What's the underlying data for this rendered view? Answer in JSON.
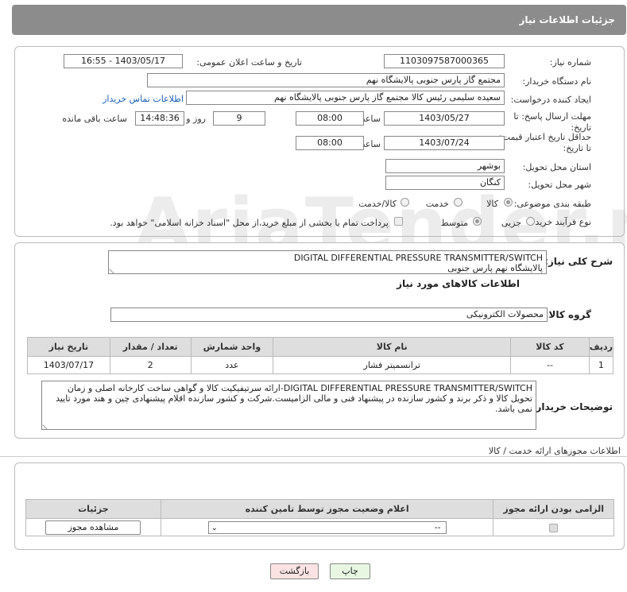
{
  "header": {
    "title": "جزئیات اطلاعات نیاز"
  },
  "form": {
    "need_number_label": "شماره نیاز:",
    "need_number": "1103097587000365",
    "announce_label": "تاریخ و ساعت اعلان عمومی:",
    "announce_value": "1403/05/17 - 16:55",
    "buyer_label": "نام دستگاه خریدار:",
    "buyer_value": "مجتمع گاز پارس جنوبی  پالایشگاه نهم",
    "creator_label": "ایجاد کننده درخواست:",
    "creator_value": "سعیده سلیمی رئیس کالا مجتمع گاز پارس جنوبی  پالایشگاه نهم",
    "contact_link": "اطلاعات تماس خریدار",
    "send_deadline_label": "مهلت ارسال پاسخ: تا تاریخ:",
    "send_date": "1403/05/27",
    "time_label": "ساعت",
    "send_time": "08:00",
    "days_value": "9",
    "days_label": "روز و",
    "remaining_time": "14:48:36",
    "remaining_label": "ساعت باقی مانده",
    "validity_label": "حداقل تاریخ اعتبار قیمت: تا تاریخ:",
    "validity_date": "1403/07/24",
    "validity_time_label": "ساعت",
    "validity_time": "08:00",
    "province_label": "استان محل تحویل:",
    "province_value": "بوشهر",
    "city_label": "شهر محل تحویل:",
    "city_value": "کنگان",
    "category_label": "طبقه بندی موضوعی:",
    "category_options": [
      "کالا",
      "خدمت",
      "کالا/خدمت"
    ],
    "process_label": "نوع فرآیند خرید :",
    "process_options": [
      "جزیی",
      "متوسط"
    ],
    "payment_note": "پرداخت تمام یا بخشی از مبلغ خرید،از محل \"اسناد خزانه اسلامی\" خواهد بود."
  },
  "watermark": "AriaTender.net",
  "description": {
    "label": "شرح کلی نیاز:",
    "line1": "DIGITAL DIFFERENTIAL PRESSURE TRANSMITTER/SWITCH",
    "line2": "پالایشگاه نهم پارس جنوبی"
  },
  "goods": {
    "section_title": "اطلاعات کالاهای مورد نیاز",
    "group_label": "گروه کالا:",
    "group_value": "محصولات الکترونیکی",
    "columns": [
      "ردیف",
      "کد کالا",
      "نام کالا",
      "واحد شمارش",
      "تعداد / مقدار",
      "تاریخ نیاز"
    ],
    "rows": [
      {
        "row": "1",
        "code": "--",
        "name": "ترانسمیتر فشار",
        "unit": "عدد",
        "qty": "2",
        "date": "1403/07/17"
      }
    ]
  },
  "buyer_notes": {
    "label": "توضیحات خریدار:",
    "text": "DIGITAL DIFFERENTIAL PRESSURE TRANSMITTER/SWITCH-ارائه سرتیفیکیت کالا و گواهی ساخت کارخانه اصلی و زمان تحویل کالا و ذکر برند و کشور سازنده در پیشنهاد فنی و مالی الزامیست.شرکت و کشور سازنده اقلام پیشنهادی چین و هند مورد تایید نمی باشد."
  },
  "permits": {
    "section_title": "اطلاعات مجوزهای ارائه خدمت / کالا",
    "columns": [
      "الزامی بودن ارائه مجوز",
      "اعلام وضعیت مجوز توسط تامین کننده",
      "جزئیات"
    ],
    "select_value": "--",
    "view_button": "مشاهده مجوز"
  },
  "actions": {
    "print": "چاپ",
    "back": "بازگشت"
  }
}
